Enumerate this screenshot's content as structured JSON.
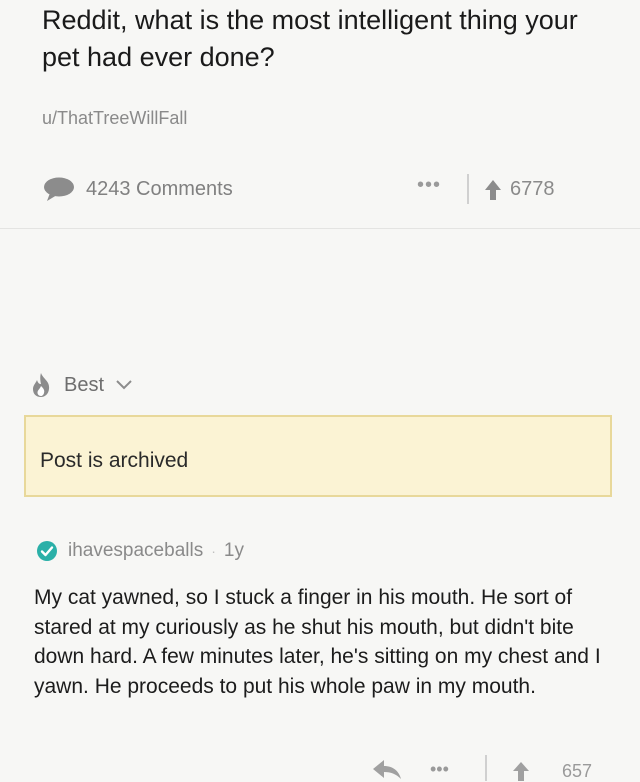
{
  "post": {
    "title": "Reddit, what is the most intelligent thing your pet had ever done?",
    "author": "u/ThatTreeWillFall",
    "comments_label": "4243 Comments",
    "more_label": "•••",
    "score": "6778"
  },
  "sort": {
    "label": "Best"
  },
  "banner": {
    "text": "Post is archived"
  },
  "comment": {
    "username": "ihavespaceballs",
    "separator": "·",
    "age": "1y",
    "body": "My cat yawned, so I stuck a finger in his mouth. He sort of stared at my curiously as he shut his mouth, but didn't bite down hard. A few minutes later, he's sitting on my chest and I yawn. He proceeds to put his whole paw in my mouth.",
    "more_label": "•••",
    "score": "657"
  },
  "icons": {
    "comments": "speech-bubble-icon",
    "upvote": "upvote-arrow-icon",
    "sort": "flame-icon",
    "verified": "verified-check-icon",
    "reply": "reply-arrow-icon"
  },
  "colors": {
    "banner_bg": "#fbf3d4",
    "banner_border": "#e8d89a",
    "verified": "#2bb0a8"
  }
}
